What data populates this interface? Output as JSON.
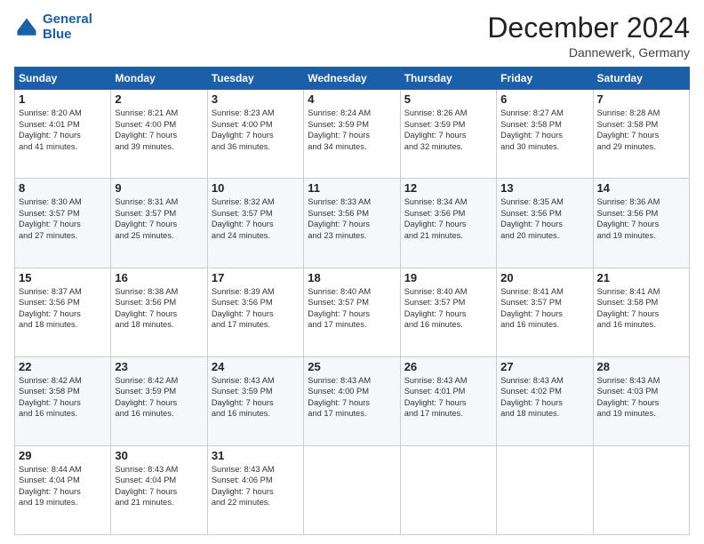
{
  "header": {
    "logo_line1": "General",
    "logo_line2": "Blue",
    "month": "December 2024",
    "location": "Dannewerk, Germany"
  },
  "weekdays": [
    "Sunday",
    "Monday",
    "Tuesday",
    "Wednesday",
    "Thursday",
    "Friday",
    "Saturday"
  ],
  "weeks": [
    [
      {
        "day": "1",
        "lines": [
          "Sunrise: 8:20 AM",
          "Sunset: 4:01 PM",
          "Daylight: 7 hours",
          "and 41 minutes."
        ]
      },
      {
        "day": "2",
        "lines": [
          "Sunrise: 8:21 AM",
          "Sunset: 4:00 PM",
          "Daylight: 7 hours",
          "and 39 minutes."
        ]
      },
      {
        "day": "3",
        "lines": [
          "Sunrise: 8:23 AM",
          "Sunset: 4:00 PM",
          "Daylight: 7 hours",
          "and 36 minutes."
        ]
      },
      {
        "day": "4",
        "lines": [
          "Sunrise: 8:24 AM",
          "Sunset: 3:59 PM",
          "Daylight: 7 hours",
          "and 34 minutes."
        ]
      },
      {
        "day": "5",
        "lines": [
          "Sunrise: 8:26 AM",
          "Sunset: 3:59 PM",
          "Daylight: 7 hours",
          "and 32 minutes."
        ]
      },
      {
        "day": "6",
        "lines": [
          "Sunrise: 8:27 AM",
          "Sunset: 3:58 PM",
          "Daylight: 7 hours",
          "and 30 minutes."
        ]
      },
      {
        "day": "7",
        "lines": [
          "Sunrise: 8:28 AM",
          "Sunset: 3:58 PM",
          "Daylight: 7 hours",
          "and 29 minutes."
        ]
      }
    ],
    [
      {
        "day": "8",
        "lines": [
          "Sunrise: 8:30 AM",
          "Sunset: 3:57 PM",
          "Daylight: 7 hours",
          "and 27 minutes."
        ]
      },
      {
        "day": "9",
        "lines": [
          "Sunrise: 8:31 AM",
          "Sunset: 3:57 PM",
          "Daylight: 7 hours",
          "and 25 minutes."
        ]
      },
      {
        "day": "10",
        "lines": [
          "Sunrise: 8:32 AM",
          "Sunset: 3:57 PM",
          "Daylight: 7 hours",
          "and 24 minutes."
        ]
      },
      {
        "day": "11",
        "lines": [
          "Sunrise: 8:33 AM",
          "Sunset: 3:56 PM",
          "Daylight: 7 hours",
          "and 23 minutes."
        ]
      },
      {
        "day": "12",
        "lines": [
          "Sunrise: 8:34 AM",
          "Sunset: 3:56 PM",
          "Daylight: 7 hours",
          "and 21 minutes."
        ]
      },
      {
        "day": "13",
        "lines": [
          "Sunrise: 8:35 AM",
          "Sunset: 3:56 PM",
          "Daylight: 7 hours",
          "and 20 minutes."
        ]
      },
      {
        "day": "14",
        "lines": [
          "Sunrise: 8:36 AM",
          "Sunset: 3:56 PM",
          "Daylight: 7 hours",
          "and 19 minutes."
        ]
      }
    ],
    [
      {
        "day": "15",
        "lines": [
          "Sunrise: 8:37 AM",
          "Sunset: 3:56 PM",
          "Daylight: 7 hours",
          "and 18 minutes."
        ]
      },
      {
        "day": "16",
        "lines": [
          "Sunrise: 8:38 AM",
          "Sunset: 3:56 PM",
          "Daylight: 7 hours",
          "and 18 minutes."
        ]
      },
      {
        "day": "17",
        "lines": [
          "Sunrise: 8:39 AM",
          "Sunset: 3:56 PM",
          "Daylight: 7 hours",
          "and 17 minutes."
        ]
      },
      {
        "day": "18",
        "lines": [
          "Sunrise: 8:40 AM",
          "Sunset: 3:57 PM",
          "Daylight: 7 hours",
          "and 17 minutes."
        ]
      },
      {
        "day": "19",
        "lines": [
          "Sunrise: 8:40 AM",
          "Sunset: 3:57 PM",
          "Daylight: 7 hours",
          "and 16 minutes."
        ]
      },
      {
        "day": "20",
        "lines": [
          "Sunrise: 8:41 AM",
          "Sunset: 3:57 PM",
          "Daylight: 7 hours",
          "and 16 minutes."
        ]
      },
      {
        "day": "21",
        "lines": [
          "Sunrise: 8:41 AM",
          "Sunset: 3:58 PM",
          "Daylight: 7 hours",
          "and 16 minutes."
        ]
      }
    ],
    [
      {
        "day": "22",
        "lines": [
          "Sunrise: 8:42 AM",
          "Sunset: 3:58 PM",
          "Daylight: 7 hours",
          "and 16 minutes."
        ]
      },
      {
        "day": "23",
        "lines": [
          "Sunrise: 8:42 AM",
          "Sunset: 3:59 PM",
          "Daylight: 7 hours",
          "and 16 minutes."
        ]
      },
      {
        "day": "24",
        "lines": [
          "Sunrise: 8:43 AM",
          "Sunset: 3:59 PM",
          "Daylight: 7 hours",
          "and 16 minutes."
        ]
      },
      {
        "day": "25",
        "lines": [
          "Sunrise: 8:43 AM",
          "Sunset: 4:00 PM",
          "Daylight: 7 hours",
          "and 17 minutes."
        ]
      },
      {
        "day": "26",
        "lines": [
          "Sunrise: 8:43 AM",
          "Sunset: 4:01 PM",
          "Daylight: 7 hours",
          "and 17 minutes."
        ]
      },
      {
        "day": "27",
        "lines": [
          "Sunrise: 8:43 AM",
          "Sunset: 4:02 PM",
          "Daylight: 7 hours",
          "and 18 minutes."
        ]
      },
      {
        "day": "28",
        "lines": [
          "Sunrise: 8:43 AM",
          "Sunset: 4:03 PM",
          "Daylight: 7 hours",
          "and 19 minutes."
        ]
      }
    ],
    [
      {
        "day": "29",
        "lines": [
          "Sunrise: 8:44 AM",
          "Sunset: 4:04 PM",
          "Daylight: 7 hours",
          "and 19 minutes."
        ]
      },
      {
        "day": "30",
        "lines": [
          "Sunrise: 8:43 AM",
          "Sunset: 4:04 PM",
          "Daylight: 7 hours",
          "and 21 minutes."
        ]
      },
      {
        "day": "31",
        "lines": [
          "Sunrise: 8:43 AM",
          "Sunset: 4:06 PM",
          "Daylight: 7 hours",
          "and 22 minutes."
        ]
      },
      null,
      null,
      null,
      null
    ]
  ]
}
